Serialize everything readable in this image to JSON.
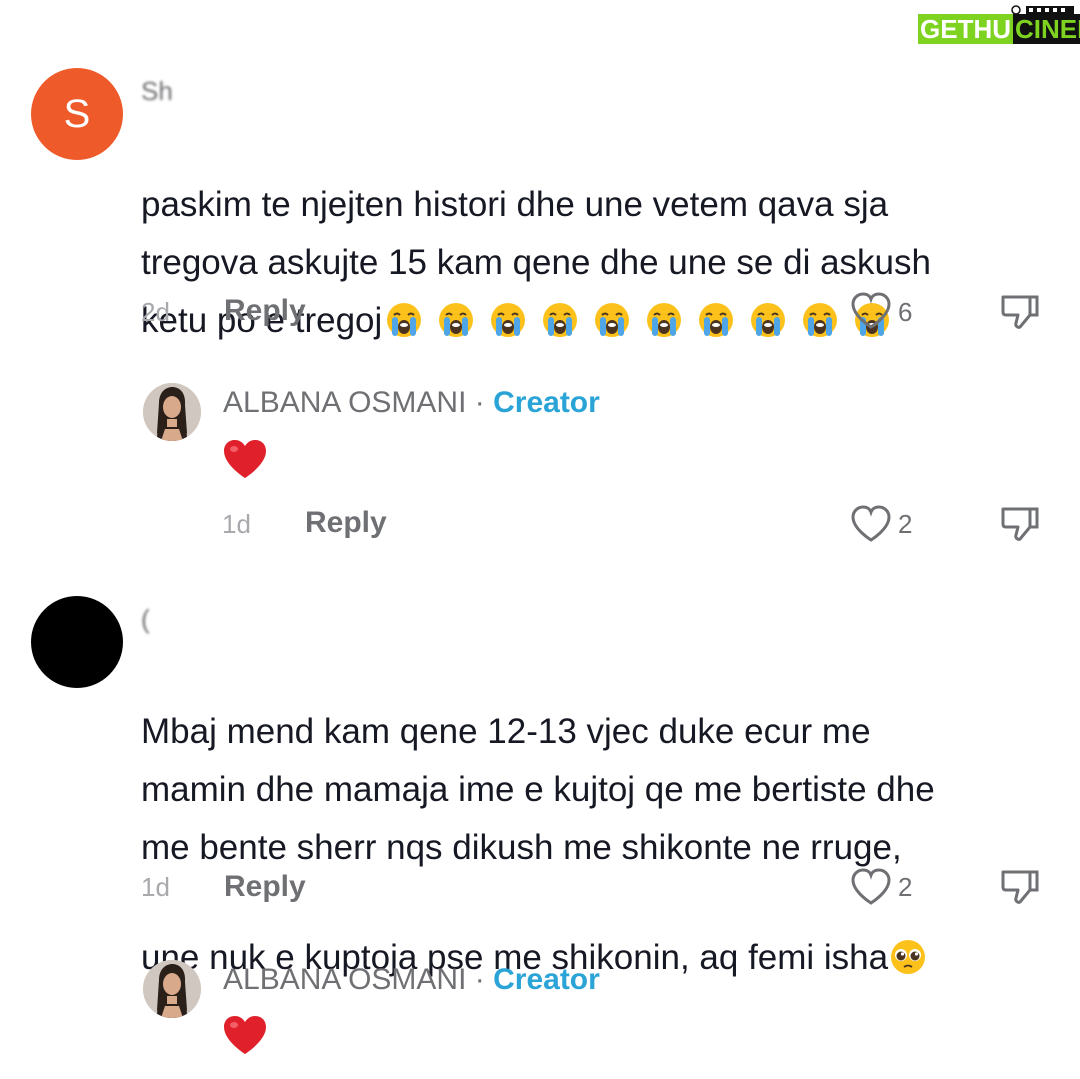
{
  "brand": {
    "part1": "GETHU",
    "part2": "CINEMA",
    "color_green": "#7ed321",
    "color_dark": "#111111"
  },
  "comments": [
    {
      "avatar_letter": "S",
      "avatar_color": "#ef5a2a",
      "username": "Sh",
      "text": "paskim te njejten histori dhe une vetem qava sja\ntregova askujte 15 kam qene dhe une se di askush\nketu po e tregoj",
      "emoji": "loudly-crying-face",
      "emoji_count": 10,
      "time": "2d",
      "reply_label": "Reply",
      "likes": "6",
      "reply": {
        "username": "ALBANA OSMANI",
        "separator": "·",
        "badge": "Creator",
        "content_emoji": "red-heart",
        "time": "1d",
        "reply_label": "Reply",
        "likes": "2"
      }
    },
    {
      "avatar_color": "#000000",
      "username": "(",
      "text": "Mbaj mend kam qene 12-13 vjec duke ecur me\nmamin dhe mamaja ime e kujtoj qe me bertiste dhe\nme bente sherr nqs dikush me shikonte ne rruge,\nune nuk e kuptoja pse me shikonin, aq femi isha",
      "emoji": "pleading-face",
      "time": "1d",
      "reply_label": "Reply",
      "likes": "2",
      "reply": {
        "username": "ALBANA OSMANI",
        "separator": "·",
        "badge": "Creator",
        "content_emoji": "red-heart"
      }
    }
  ],
  "colors": {
    "creator": "#2aa4d6",
    "muted": "#6f7073",
    "heart": "#e0202a"
  }
}
